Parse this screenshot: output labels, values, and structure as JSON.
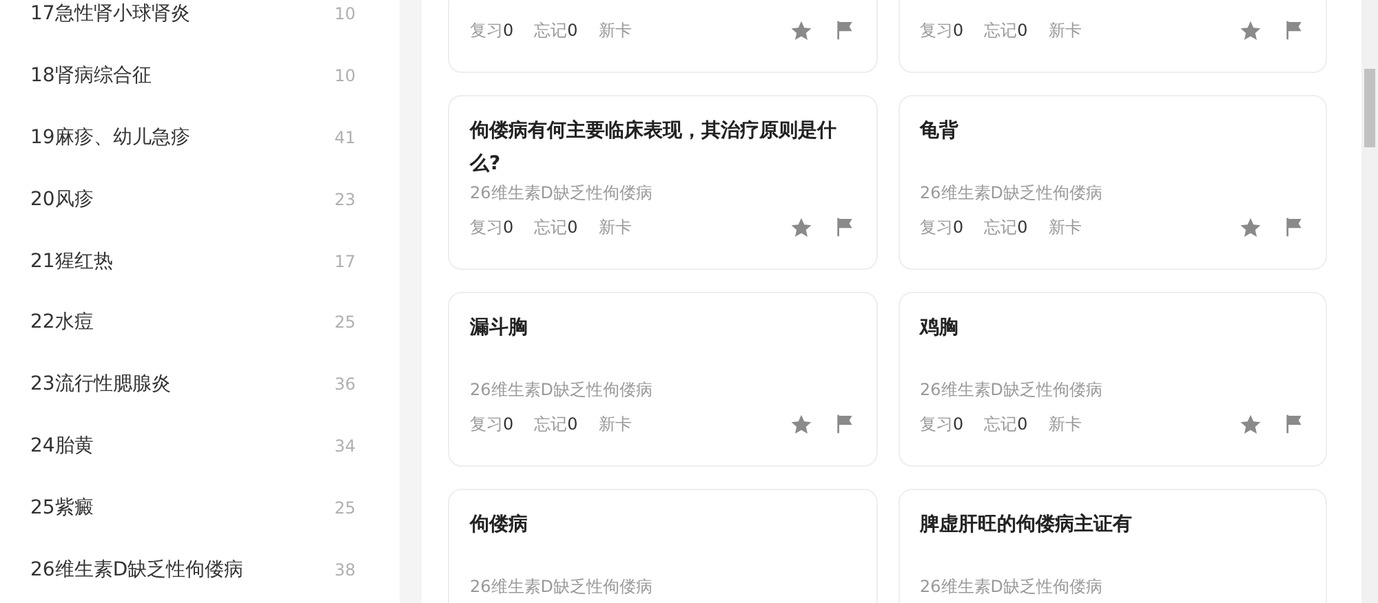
{
  "sidebar": {
    "items": [
      {
        "label": "17急性肾小球肾炎",
        "count": "10"
      },
      {
        "label": "18肾病综合征",
        "count": "10"
      },
      {
        "label": "19麻疹、幼儿急疹",
        "count": "41"
      },
      {
        "label": "20风疹",
        "count": "23"
      },
      {
        "label": "21猩红热",
        "count": "17"
      },
      {
        "label": "22水痘",
        "count": "25"
      },
      {
        "label": "23流行性腮腺炎",
        "count": "36"
      },
      {
        "label": "24胎黄",
        "count": "34"
      },
      {
        "label": "25紫癜",
        "count": "25"
      },
      {
        "label": "26维生素D缺乏性佝偻病",
        "count": "38"
      }
    ]
  },
  "cards": [
    {
      "stats": [
        {
          "label": "复习",
          "value": "0"
        },
        {
          "label": "忘记",
          "value": "0"
        },
        {
          "label": "新卡"
        }
      ]
    },
    {
      "stats": [
        {
          "label": "复习",
          "value": "0"
        },
        {
          "label": "忘记",
          "value": "0"
        },
        {
          "label": "新卡"
        }
      ]
    },
    {
      "title": "佝偻病有何主要临床表现，其治疗原则是什么?",
      "category": "26维生素D缺乏性佝偻病",
      "stats": [
        {
          "label": "复习",
          "value": "0"
        },
        {
          "label": "忘记",
          "value": "0"
        },
        {
          "label": "新卡"
        }
      ]
    },
    {
      "title": "龟背",
      "category": "26维生素D缺乏性佝偻病",
      "stats": [
        {
          "label": "复习",
          "value": "0"
        },
        {
          "label": "忘记",
          "value": "0"
        },
        {
          "label": "新卡"
        }
      ]
    },
    {
      "title": "漏斗胸",
      "category": "26维生素D缺乏性佝偻病",
      "stats": [
        {
          "label": "复习",
          "value": "0"
        },
        {
          "label": "忘记",
          "value": "0"
        },
        {
          "label": "新卡"
        }
      ]
    },
    {
      "title": "鸡胸",
      "category": "26维生素D缺乏性佝偻病",
      "stats": [
        {
          "label": "复习",
          "value": "0"
        },
        {
          "label": "忘记",
          "value": "0"
        },
        {
          "label": "新卡"
        }
      ]
    },
    {
      "title": "佝偻病",
      "category": "26维生素D缺乏性佝偻病"
    },
    {
      "title": "脾虚肝旺的佝偻病主证有",
      "category": "26维生素D缺乏性佝偻病"
    }
  ]
}
